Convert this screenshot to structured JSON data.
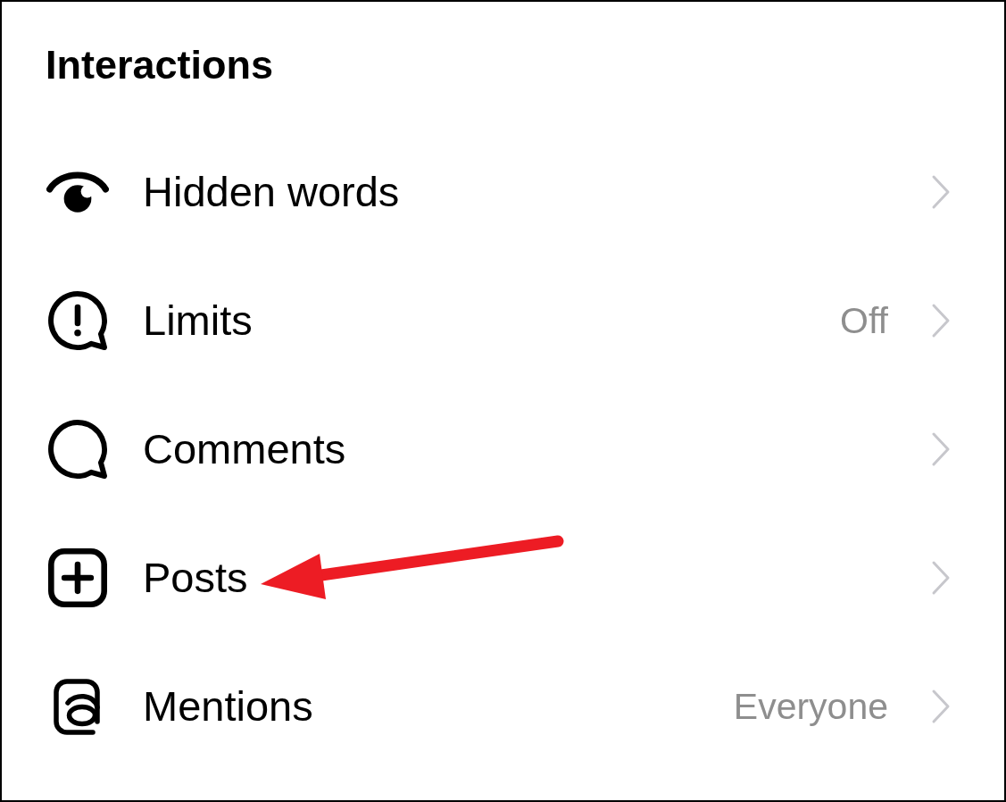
{
  "title": "Interactions",
  "items": [
    {
      "label": "Hidden words"
    },
    {
      "label": "Limits",
      "value": "Off"
    },
    {
      "label": "Comments"
    },
    {
      "label": "Posts"
    },
    {
      "label": "Mentions",
      "value": "Everyone"
    }
  ]
}
